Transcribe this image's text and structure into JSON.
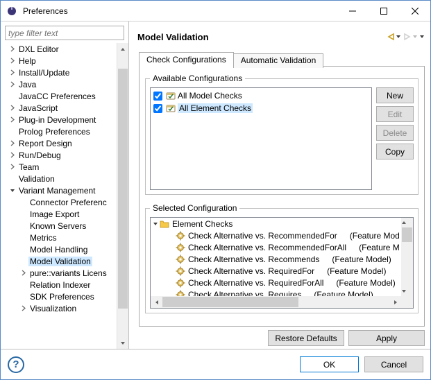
{
  "window": {
    "title": "Preferences"
  },
  "filter": {
    "placeholder": "type filter text"
  },
  "tree": {
    "items": [
      {
        "label": "DXL Editor",
        "depth": 1,
        "expandable": true
      },
      {
        "label": "Help",
        "depth": 1,
        "expandable": true
      },
      {
        "label": "Install/Update",
        "depth": 1,
        "expandable": true
      },
      {
        "label": "Java",
        "depth": 1,
        "expandable": true
      },
      {
        "label": "JavaCC Preferences",
        "depth": 1,
        "expandable": false
      },
      {
        "label": "JavaScript",
        "depth": 1,
        "expandable": true
      },
      {
        "label": "Plug-in Development",
        "depth": 1,
        "expandable": true
      },
      {
        "label": "Prolog Preferences",
        "depth": 1,
        "expandable": false
      },
      {
        "label": "Report Design",
        "depth": 1,
        "expandable": true
      },
      {
        "label": "Run/Debug",
        "depth": 1,
        "expandable": true
      },
      {
        "label": "Team",
        "depth": 1,
        "expandable": true
      },
      {
        "label": "Validation",
        "depth": 1,
        "expandable": false
      },
      {
        "label": "Variant Management",
        "depth": 1,
        "expandable": true,
        "expanded": true
      },
      {
        "label": "Connector Preferenc",
        "depth": 2,
        "expandable": false
      },
      {
        "label": "Image Export",
        "depth": 2,
        "expandable": false
      },
      {
        "label": "Known Servers",
        "depth": 2,
        "expandable": false
      },
      {
        "label": "Metrics",
        "depth": 2,
        "expandable": false
      },
      {
        "label": "Model Handling",
        "depth": 2,
        "expandable": false
      },
      {
        "label": "Model Validation",
        "depth": 2,
        "expandable": false,
        "selected": true
      },
      {
        "label": "pure::variants Licens",
        "depth": 2,
        "expandable": true
      },
      {
        "label": "Relation Indexer",
        "depth": 2,
        "expandable": false
      },
      {
        "label": "SDK Preferences",
        "depth": 2,
        "expandable": false
      },
      {
        "label": "Visualization",
        "depth": 2,
        "expandable": true
      }
    ]
  },
  "page": {
    "title": "Model Validation",
    "tabs": [
      {
        "id": "check-config",
        "label": "Check Configurations",
        "active": true
      },
      {
        "id": "auto-valid",
        "label": "Automatic Validation",
        "active": false
      }
    ],
    "avail_group": "Available Configurations",
    "avail_items": [
      {
        "label": "All Model Checks",
        "checked": true,
        "selected": false
      },
      {
        "label": "All Element Checks",
        "checked": true,
        "selected": true
      }
    ],
    "buttons": {
      "new": "New",
      "edit": "Edit",
      "delete": "Delete",
      "copy": "Copy"
    },
    "sel_group": "Selected Configuration",
    "sel_root": {
      "label": "Element Checks"
    },
    "sel_items": [
      {
        "name": "Check Alternative vs. RecommendedFor",
        "suffix": "(Feature Mod"
      },
      {
        "name": "Check Alternative vs. RecommendedForAll",
        "suffix": "(Feature M"
      },
      {
        "name": "Check Alternative vs. Recommends",
        "suffix": "(Feature Model)"
      },
      {
        "name": "Check Alternative vs. RequiredFor",
        "suffix": "(Feature Model)"
      },
      {
        "name": "Check Alternative vs. RequiredForAll",
        "suffix": "(Feature Model)"
      },
      {
        "name": "Check Alternative vs. Requires",
        "suffix": "(Feature Model)"
      }
    ],
    "footer": {
      "restore": "Restore Defaults",
      "apply": "Apply"
    }
  },
  "dialog_buttons": {
    "ok": "OK",
    "cancel": "Cancel"
  }
}
